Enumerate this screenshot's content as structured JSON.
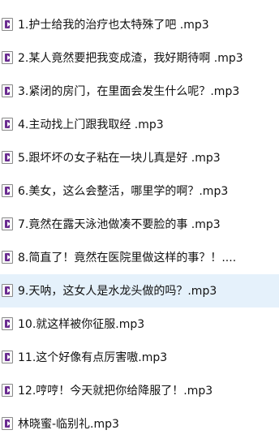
{
  "file_list": {
    "selected_index": 8,
    "icon": "audio-file-icon",
    "items": [
      {
        "name": "1.护士给我的治疗也太特殊了吧 .mp3"
      },
      {
        "name": "2.某人竟然要把我变成渣，我好期待啊 .mp3"
      },
      {
        "name": "3.紧闭的房门，在里面会发生什么呢？.mp3"
      },
      {
        "name": "4.主动找上门跟我取经 .mp3"
      },
      {
        "name": "5.跟坏坏の女子粘在一块儿真是好 .mp3"
      },
      {
        "name": "6.美女，这么会整活，哪里学的啊？.mp3"
      },
      {
        "name": "7.竟然在露天泳池做凑不要脸的事 .mp3"
      },
      {
        "name": "8.简直了！竟然在医院里做这样的事？！...."
      },
      {
        "name": "9.天呐，这女人是水龙头做的吗？.mp3"
      },
      {
        "name": "10.就这样被你征服.mp3"
      },
      {
        "name": "11.这个好像有点厉害嗷.mp3"
      },
      {
        "name": "12.哼哼！今天就把你给降服了！.mp3"
      },
      {
        "name": "林晓蜜-临别礼.mp3"
      }
    ]
  }
}
